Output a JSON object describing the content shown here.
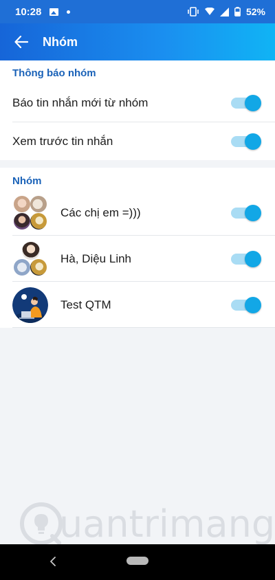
{
  "status_bar": {
    "time": "10:28",
    "battery": "52%"
  },
  "header": {
    "title": "Nhóm"
  },
  "notifications_section": {
    "heading": "Thông báo nhóm",
    "items": [
      {
        "label": "Báo tin nhắn mới từ nhóm",
        "enabled": true
      },
      {
        "label": "Xem trước tin nhắn",
        "enabled": true
      }
    ]
  },
  "groups_section": {
    "heading": "Nhóm",
    "items": [
      {
        "name": "Các chị em =)))",
        "enabled": true,
        "avatar": "group-collage-4"
      },
      {
        "name": "Hà, Diệu Linh",
        "enabled": true,
        "avatar": "group-collage-2"
      },
      {
        "name": "Test QTM",
        "enabled": true,
        "avatar": "person-laptop-night"
      }
    ]
  },
  "watermark": {
    "text": "uantrimang"
  },
  "colors": {
    "accent": "#12a7e6",
    "header_start": "#1665d8",
    "header_end": "#10b4f5",
    "section_heading": "#1a62b8"
  }
}
